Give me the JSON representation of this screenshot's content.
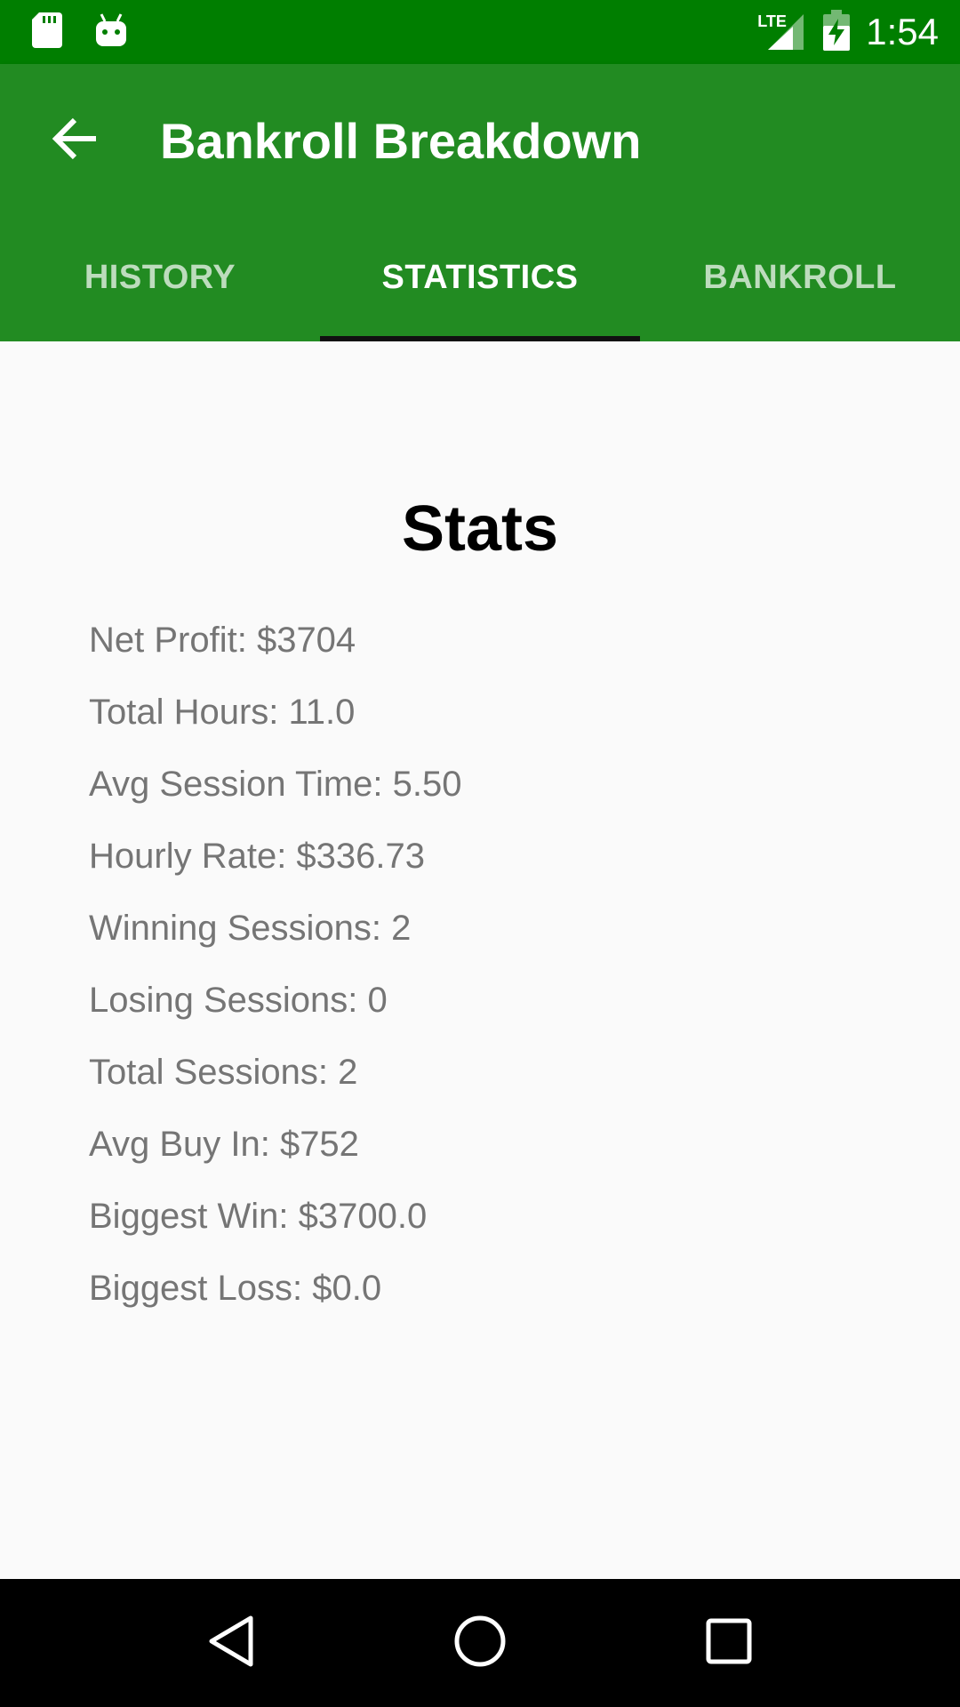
{
  "status_bar": {
    "time": "1:54",
    "network": "LTE",
    "icons": [
      "sd-card-icon",
      "android-icon",
      "signal-icon",
      "battery-charging-icon"
    ]
  },
  "app_bar": {
    "title": "Bankroll Breakdown",
    "back_icon": "arrow-back-icon"
  },
  "tabs": [
    {
      "label": "HISTORY",
      "active": false
    },
    {
      "label": "STATISTICS",
      "active": true
    },
    {
      "label": "BANKROLL",
      "active": false
    }
  ],
  "stats": {
    "heading": "Stats",
    "items": [
      "Net Profit: $3704",
      "Total Hours: 11.0",
      "Avg Session Time: 5.50",
      "Hourly Rate: $336.73",
      "Winning Sessions: 2",
      "Losing Sessions: 0",
      "Total Sessions: 2",
      "Avg Buy In: $752",
      "Biggest Win: $3700.0",
      "Biggest Loss: $0.0"
    ]
  },
  "nav_bar": {
    "icons": [
      "back-triangle-icon",
      "home-circle-icon",
      "recents-square-icon"
    ]
  },
  "colors": {
    "status_bar": "#007e00",
    "app_bar": "#228b22",
    "tab_indicator": "#111111",
    "background": "#fafafa",
    "stat_text": "#757575"
  }
}
